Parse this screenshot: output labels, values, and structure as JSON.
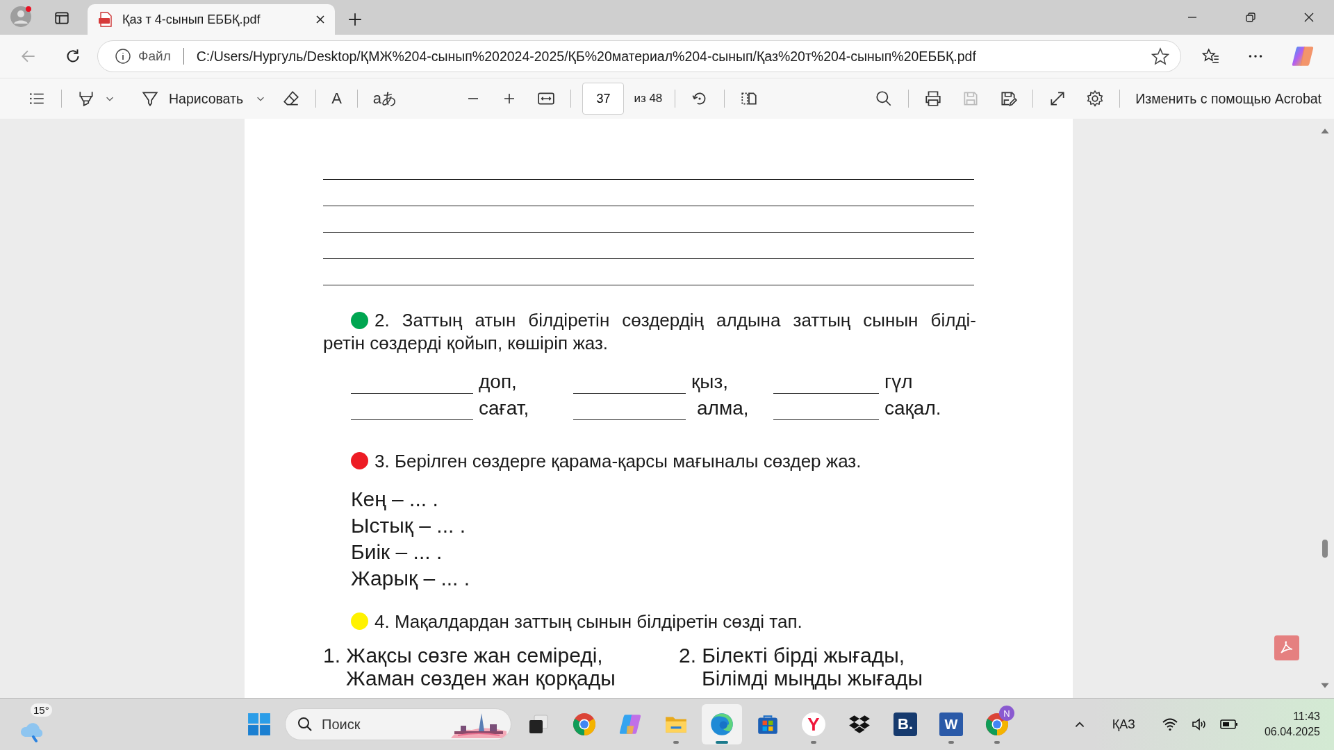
{
  "browser": {
    "tabs": [
      {
        "title": "Қаз т 4-сынып ЕББҚ.pdf",
        "selected": true
      }
    ],
    "address": {
      "scheme_label": "Файл",
      "url": "C:/Users/Нургуль/Desktop/ҚМЖ%204-сынып%202024-2025/ҚБ%20материал%204-сынып/Қаз%20т%204-сынып%20ЕББҚ.pdf"
    }
  },
  "pdf_toolbar": {
    "draw_label": "Нарисовать",
    "read_aloud_glyph": "A",
    "translate_glyph": "aあ",
    "page": "37",
    "page_total": "из 48",
    "acrobat_label": "Изменить с помощью Acrobat"
  },
  "document": {
    "task_2": {
      "color": "#00a651",
      "lines": [
        "2. Заттың атын білдіретін сөздердің алдына заттың сынын білді-",
        "ретін сөздерді қойып, көшіріп жаз."
      ],
      "rows": [
        [
          "доп,",
          "қыз,",
          "гүл"
        ],
        [
          "сағат,",
          "алма,",
          "сақал."
        ]
      ]
    },
    "task_3": {
      "color": "#ed1c24",
      "text": "3. Берілген сөздерге қарама-қарсы мағыналы сөздер жаз.",
      "items": [
        "Кең – ... .",
        "Ыстық – ... .",
        "Биік – ... .",
        "Жарық – ... ."
      ]
    },
    "task_4": {
      "color": "#fff200",
      "text": "4. Мақалдардан заттың сынын білдіретін сөзді тап.",
      "proverbs": [
        [
          "1. Жақсы сөзге жан семіреді,",
          "Жаман сөзден жан қорқады"
        ],
        [
          "2. Білекті бірді жығады,",
          "Білімді мыңды жығады"
        ]
      ]
    }
  },
  "taskbar": {
    "weather": "15°",
    "search_placeholder": "Поиск",
    "apps": [
      {
        "kind": "taskview",
        "running": false,
        "selected": false
      },
      {
        "kind": "chrome",
        "running": false,
        "selected": false
      },
      {
        "kind": "copilot",
        "running": false,
        "selected": false
      },
      {
        "kind": "folder",
        "running": true,
        "selected": false
      },
      {
        "kind": "edge",
        "running": true,
        "selected": true
      },
      {
        "kind": "store",
        "running": false,
        "selected": false
      },
      {
        "kind": "yandex",
        "label": "Y",
        "running": true,
        "selected": false
      },
      {
        "kind": "dropbox",
        "running": false,
        "selected": false
      },
      {
        "kind": "booking",
        "label": "B.",
        "running": false,
        "selected": false
      },
      {
        "kind": "word",
        "label": "W",
        "running": true,
        "selected": false
      },
      {
        "kind": "chrome",
        "badge": "N",
        "running": true,
        "selected": false
      }
    ],
    "language": "ҚАЗ",
    "time": "11:43",
    "date": "06.04.2025"
  }
}
